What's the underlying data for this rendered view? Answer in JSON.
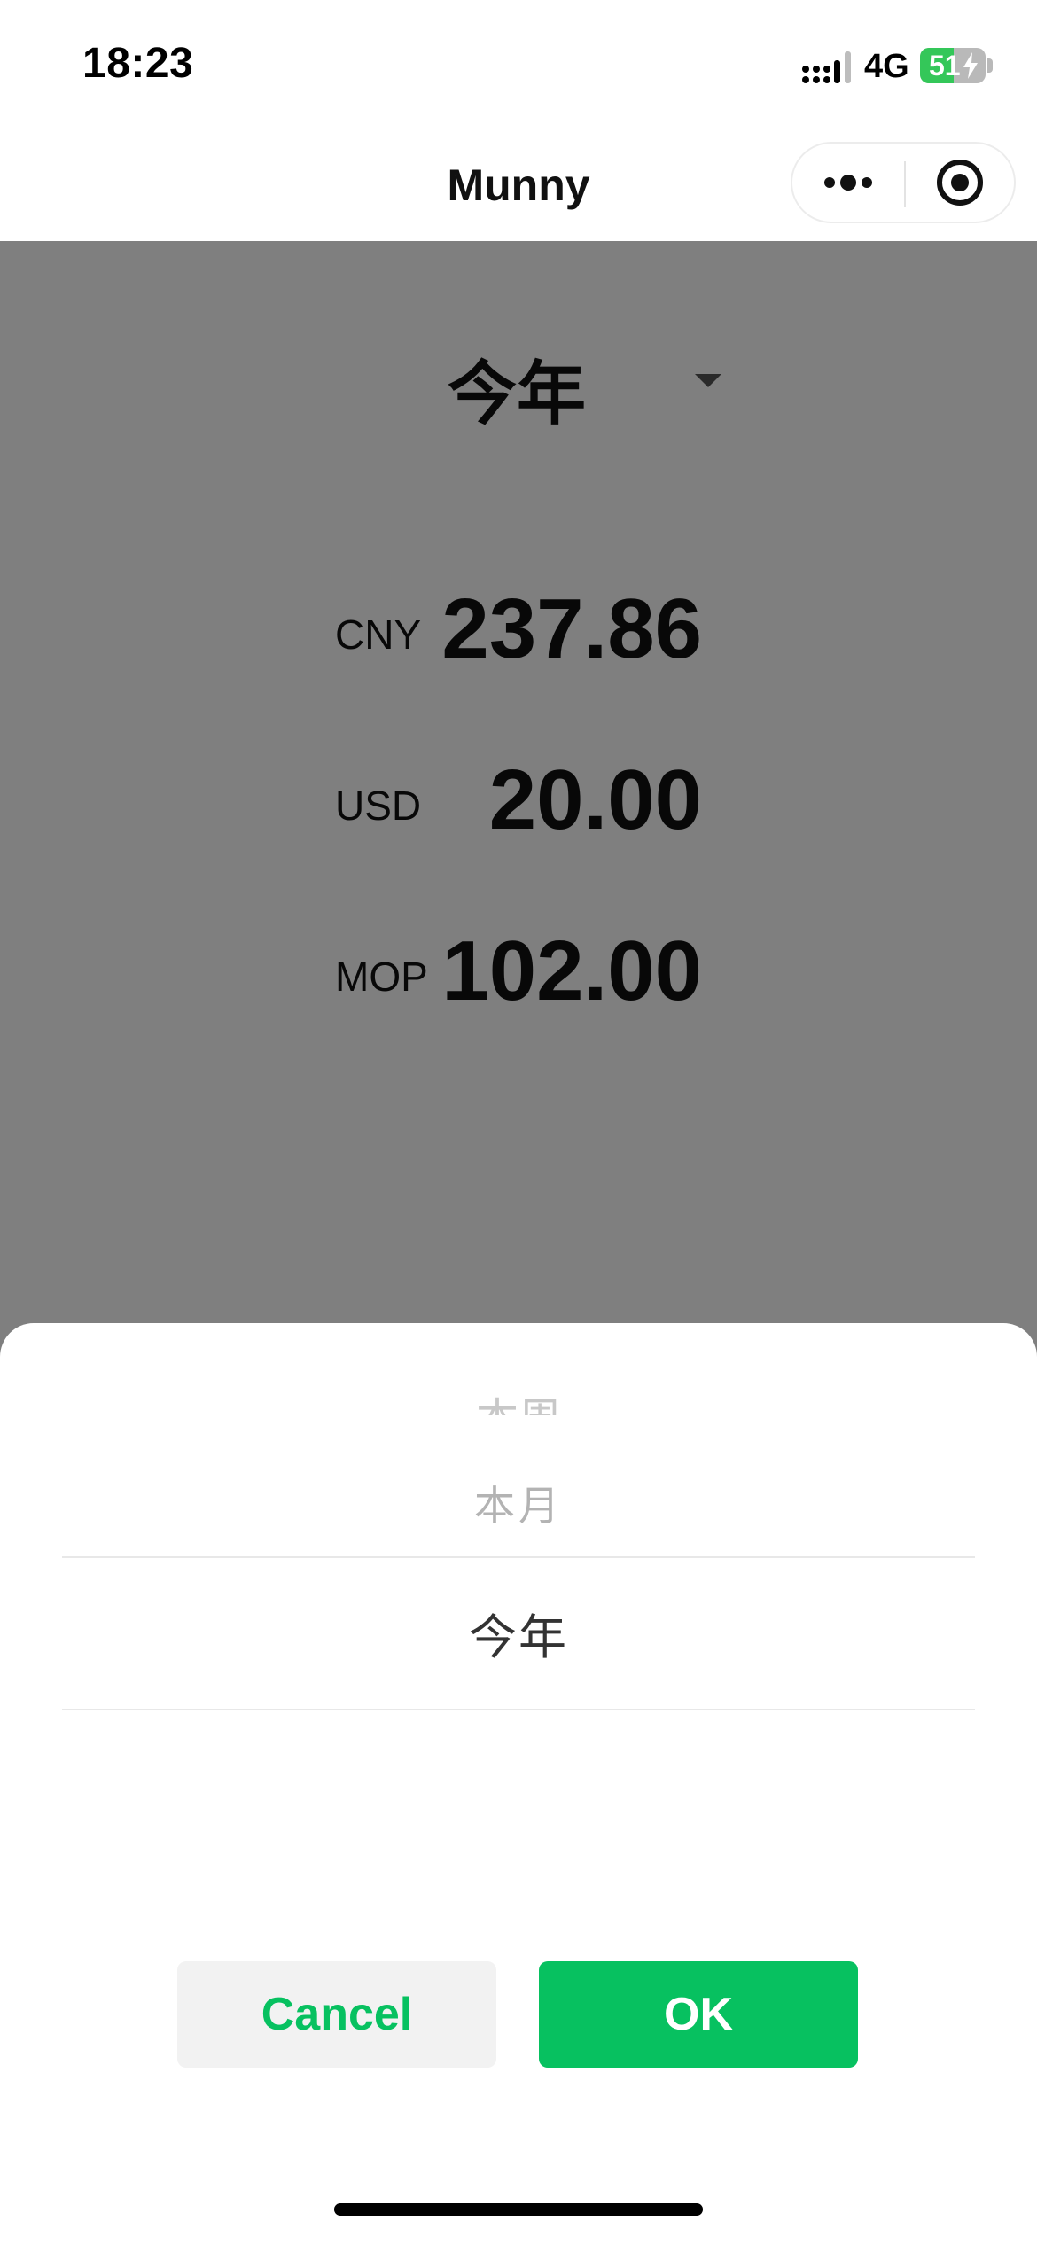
{
  "status_bar": {
    "time": "18:23",
    "network": "4G",
    "battery_level": "51",
    "battery_fraction": 0.51,
    "signal_icon": "signal-icon",
    "battery_icon": "battery-charging-icon"
  },
  "nav": {
    "title": "Munny",
    "more_icon": "more-dots-icon",
    "close_icon": "target-close-icon"
  },
  "summary": {
    "period": "今年",
    "amounts": [
      {
        "currency": "CNY",
        "value": "237.86"
      },
      {
        "currency": "USD",
        "value": "20.00"
      },
      {
        "currency": "MOP",
        "value": "102.00"
      }
    ]
  },
  "picker": {
    "items": [
      "本周",
      "本月",
      "今年"
    ],
    "selected": "今年",
    "cancel_label": "Cancel",
    "ok_label": "OK"
  },
  "colors": {
    "accent": "#07c160",
    "battery": "#34c759",
    "overlay": "rgba(0,0,0,0.5)"
  }
}
